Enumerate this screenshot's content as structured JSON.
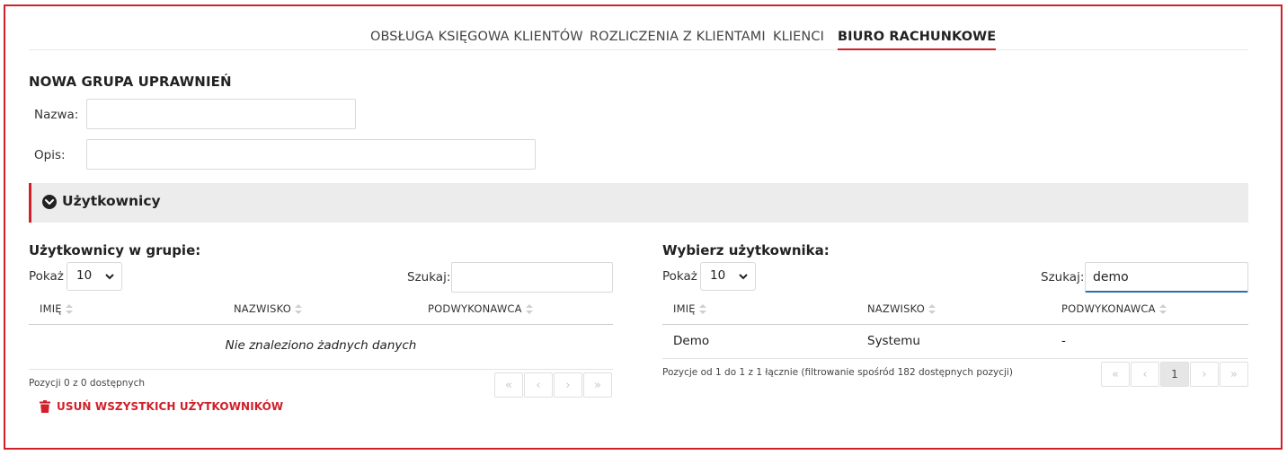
{
  "tabs": [
    {
      "label": "OBSŁUGA KSIĘGOWA KLIENTÓW"
    },
    {
      "label": "ROZLICZENIA Z KLIENTAMI"
    },
    {
      "label": "KLIENCI"
    },
    {
      "label": "BIURO RACHUNKOWE",
      "active": true
    }
  ],
  "form": {
    "title": "NOWA GRUPA UPRAWNIEŃ",
    "name_label": "Nazwa:",
    "name_value": "",
    "desc_label": "Opis:",
    "desc_value": ""
  },
  "section": {
    "title": "Użytkownicy",
    "icon": "chevron-down-circle-icon"
  },
  "group_users": {
    "title": "Użytkownicy w grupie:",
    "show_label": "Pokaż",
    "page_size": "10",
    "search_label": "Szukaj:",
    "search_value": "",
    "columns": [
      "IMIĘ",
      "NAZWISKO",
      "PODWYKONAWCA"
    ],
    "empty_text": "Nie znaleziono żadnych danych",
    "info": "Pozycji 0 z 0 dostępnych",
    "delete_all_label": "USUŃ WSZYSTKICH UŻYTKOWNIKÓW"
  },
  "select_user": {
    "title": "Wybierz użytkownika:",
    "show_label": "Pokaż",
    "page_size": "10",
    "search_label": "Szukaj:",
    "search_value": "demo",
    "columns": [
      "IMIĘ",
      "NAZWISKO",
      "PODWYKONAWCA"
    ],
    "rows": [
      {
        "first_name": "Demo",
        "last_name": "Systemu",
        "subcontractor": "-"
      }
    ],
    "info": "Pozycje od 1 do 1 z 1 łącznie (filtrowanie spośród 182 dostępnych pozycji)",
    "current_page": "1"
  },
  "pager": {
    "first": "«",
    "prev": "‹",
    "next": "›",
    "last": "»"
  },
  "colors": {
    "accent": "#d0202a",
    "section_bg": "#ececec"
  }
}
